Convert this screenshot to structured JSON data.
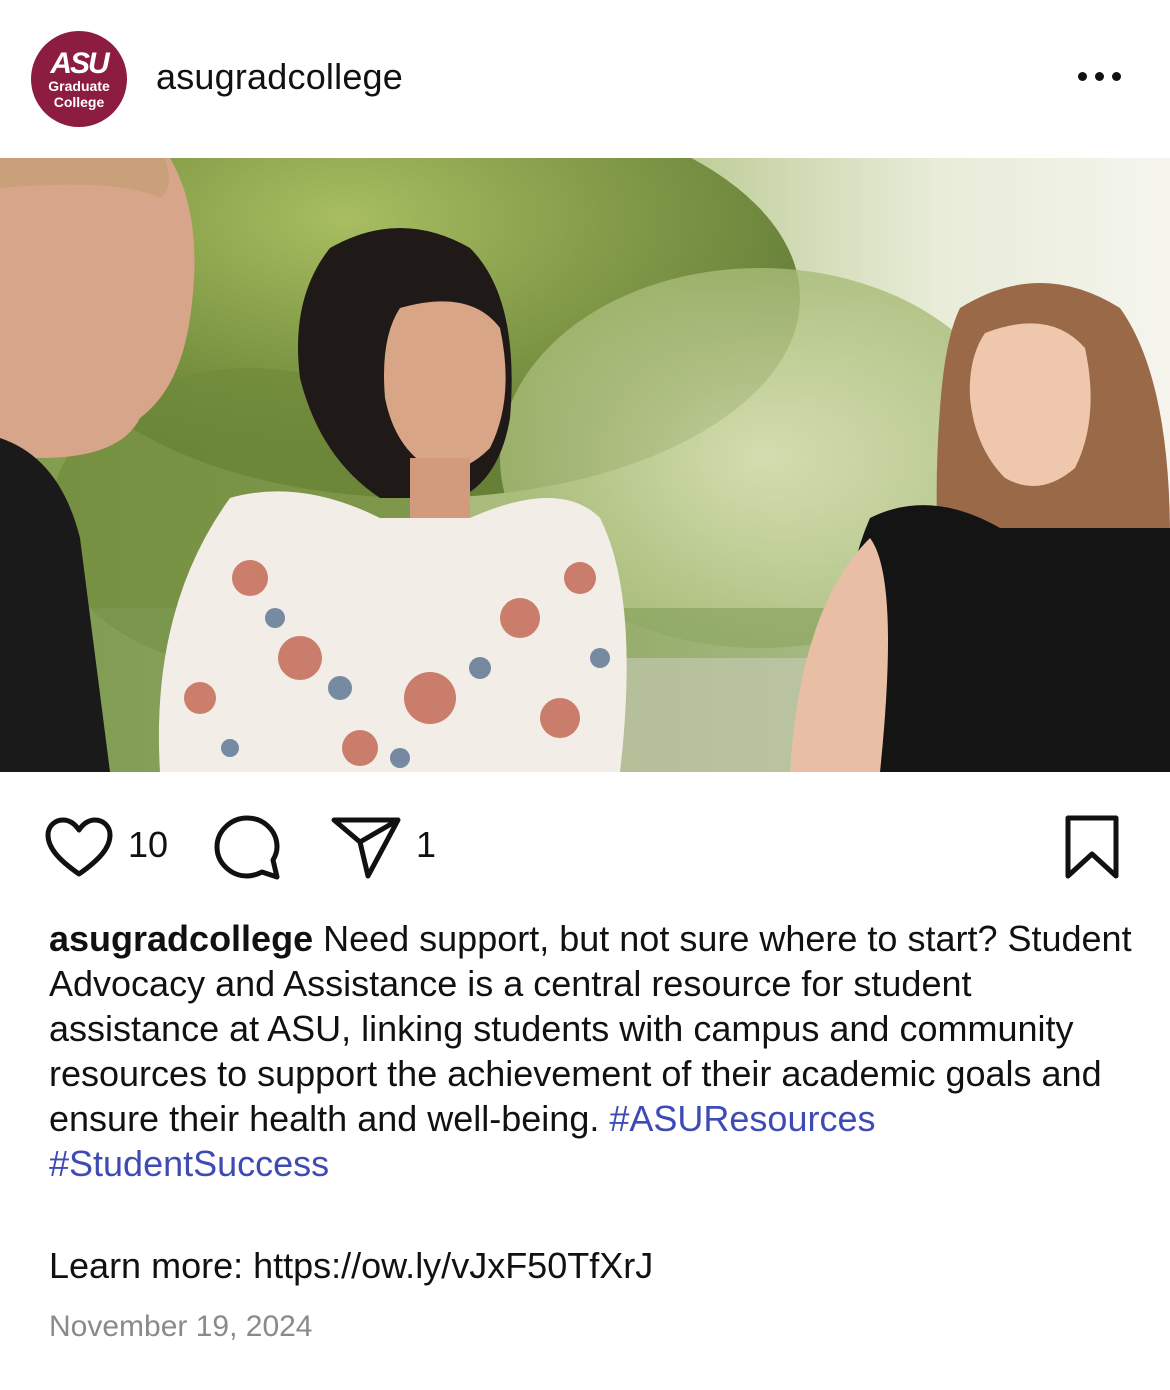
{
  "header": {
    "avatar_logo": "ASU",
    "avatar_line1": "Graduate",
    "avatar_line2": "College",
    "username": "asugradcollege",
    "more_icon": "ellipsis-icon"
  },
  "post": {
    "image_alt": "Three students talking outdoors on campus",
    "likes_count": "10",
    "shares_count": "1",
    "icons": {
      "like": "heart-icon",
      "comment": "comment-bubble-icon",
      "share": "paper-plane-icon",
      "save": "bookmark-icon"
    }
  },
  "caption": {
    "username": "asugradcollege",
    "text": " Need support, but not sure where to start? Student Advocacy and Assistance is a central resource for student assistance at ASU, linking students with campus and community resources to support the achievement of their academic goals and ensure their health and well-being. ",
    "hashtag1": "#ASUResources",
    "hashtag2": "#StudentSuccess",
    "learn_more": "Learn more: https://ow.ly/vJxF50TfXrJ",
    "date": "November 19, 2024"
  },
  "colors": {
    "brand": "#8c1d40",
    "hashtag": "#3f4bb5",
    "date": "#8a8a8a"
  }
}
